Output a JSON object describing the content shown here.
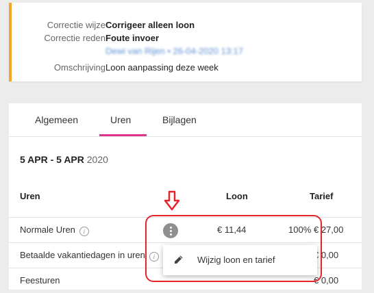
{
  "colors": {
    "accent": "#f5a623",
    "tab_active": "#e0338b",
    "annotation": "#e8222b"
  },
  "details": {
    "rows": [
      {
        "label": "Correctie wijze",
        "value": "Corrigeer alleen loon",
        "bold": true
      },
      {
        "label": "Correctie reden",
        "value": "Foute invoer",
        "bold": true
      },
      {
        "label": "",
        "value": "Dewi van Rijen • 26-04-2020 13:17",
        "blurred": true
      },
      {
        "label": "Omschrijving",
        "value": "Loon aanpassing deze week",
        "bold": false
      }
    ]
  },
  "tabs": [
    {
      "label": "Algemeen",
      "active": false
    },
    {
      "label": "Uren",
      "active": true
    },
    {
      "label": "Bijlagen",
      "active": false
    }
  ],
  "period": {
    "range": "5 APR - 5 APR",
    "year": "2020"
  },
  "table": {
    "headers": {
      "uren": "Uren",
      "loon": "Loon",
      "tarief": "Tarief"
    },
    "rows": [
      {
        "label": "Normale Uren",
        "loon": "€ 11,44",
        "pct": "100%",
        "tarief": "€ 27,00"
      },
      {
        "label": "Betaalde vakantiedagen in uren",
        "loon": "",
        "pct": "",
        "tarief": "€ 0,00"
      },
      {
        "label": "Feesturen",
        "loon": "",
        "pct": "",
        "tarief": "€ 0,00"
      }
    ]
  },
  "context_menu": {
    "item_label": "Wijzig loon en tarief",
    "item_icon": "pencil-icon"
  },
  "icons": {
    "info": "info-icon",
    "kebab": "more-vertical-icon",
    "arrow": "arrow-down-icon"
  }
}
